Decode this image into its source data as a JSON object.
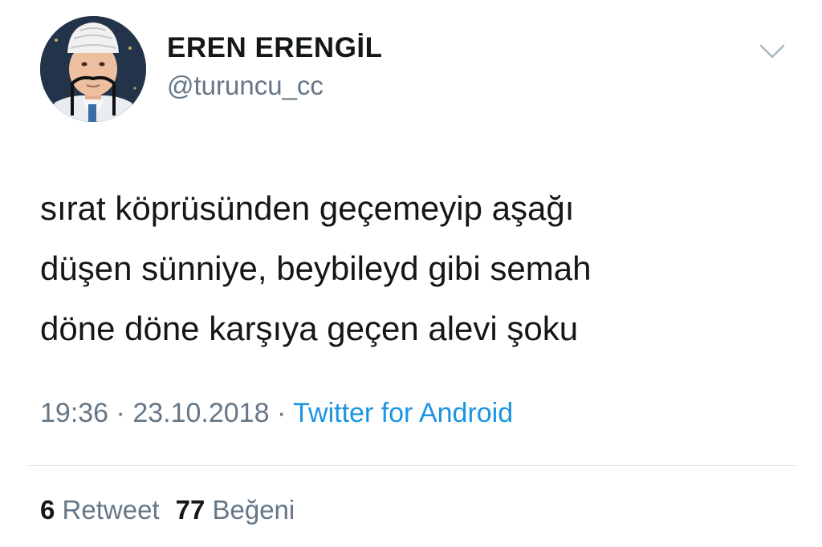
{
  "user": {
    "display_name": "EREN ERENGİL",
    "handle": "@turuncu_cc",
    "avatar_icon": "user-avatar-photo"
  },
  "tweet": {
    "text_lines": [
      "sırat köprüsünden geçemeyip aşağı",
      "düşen sünniye, beybileyd gibi semah",
      "döne döne karşıya geçen alevi şoku"
    ],
    "time": "19:36",
    "separator": "·",
    "date": "23.10.2018",
    "source": "Twitter for Android"
  },
  "stats": {
    "retweet_count": "6",
    "retweet_label": "Retweet",
    "like_count": "77",
    "like_label": "Beğeni"
  },
  "icons": {
    "menu": "chevron-down-icon"
  },
  "colors": {
    "text_primary": "#14171a",
    "text_secondary": "#657786",
    "link": "#1b95e0",
    "divider": "#e1e8ed"
  }
}
